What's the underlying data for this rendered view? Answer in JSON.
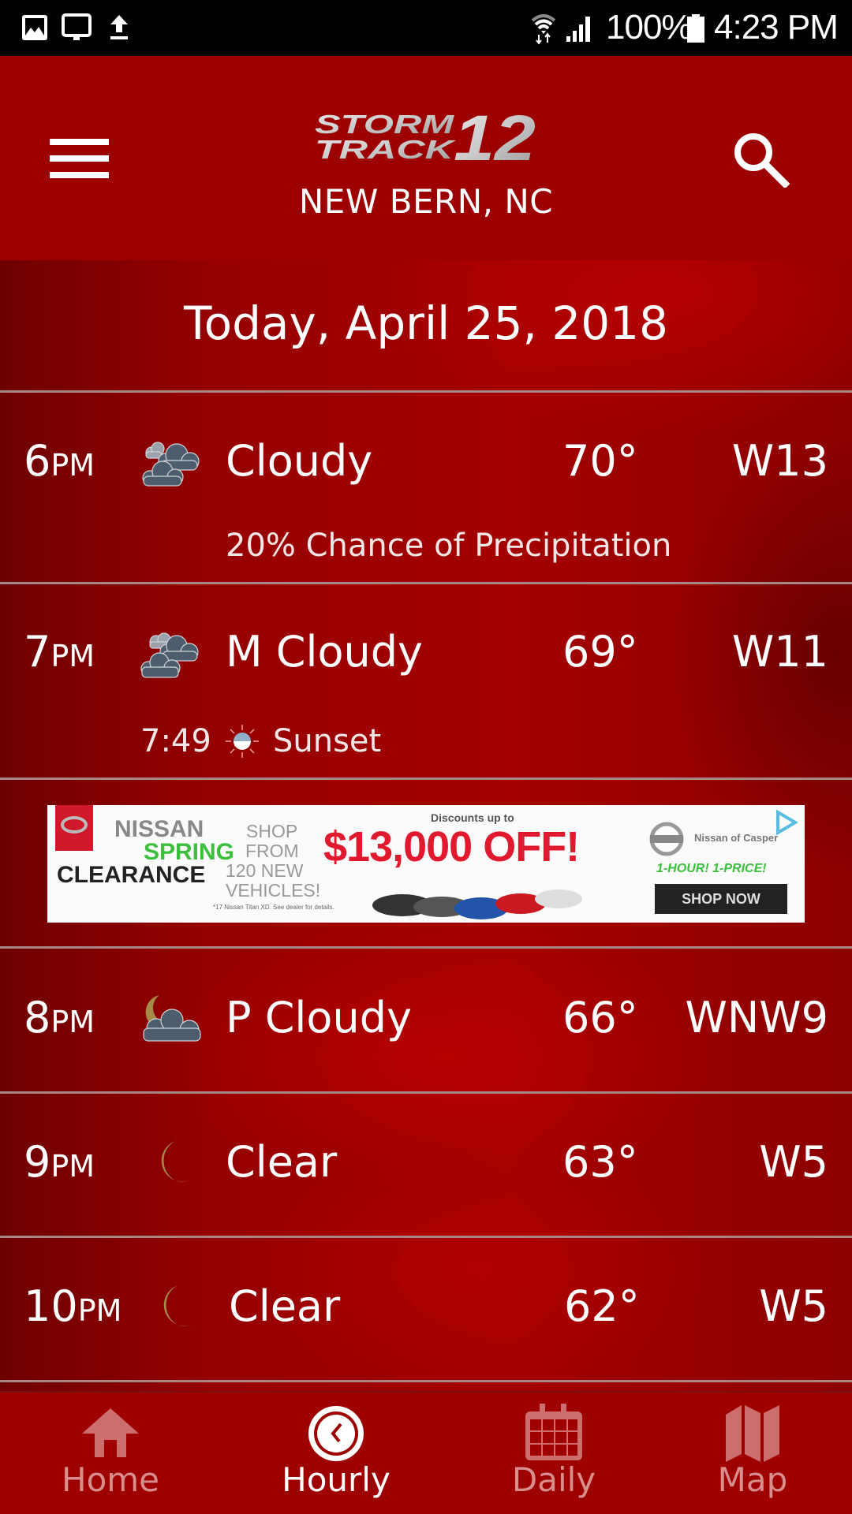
{
  "status_bar": {
    "left_icons": [
      "gallery-icon",
      "cast-screen-icon",
      "upload-icon"
    ],
    "right_icons": [
      "wifi-icon",
      "signal-icon",
      "battery-icon"
    ],
    "battery": "100%",
    "time": "4:23 PM"
  },
  "header": {
    "logo_line1": "STORM",
    "logo_line2": "TRACK",
    "logo_number": "12",
    "city": "NEW BERN, NC",
    "menu_icon": "hamburger-menu-icon",
    "search_icon": "search-icon"
  },
  "date_title": "Today, April 25, 2018",
  "hours": [
    {
      "hour": "6",
      "suffix": "PM",
      "icon": "cloudy-icon",
      "condition": "Cloudy",
      "temp": "70°",
      "wind": "W13",
      "note": "20% Chance of Precipitation"
    },
    {
      "hour": "7",
      "suffix": "PM",
      "icon": "mostly-cloudy-icon",
      "condition": "M Cloudy",
      "temp": "69°",
      "wind": "W11",
      "event": {
        "time": "7:49",
        "icon": "sunset-icon",
        "label": "Sunset"
      }
    },
    {
      "hour": "8",
      "suffix": "PM",
      "icon": "partly-cloudy-night-icon",
      "condition": "P Cloudy",
      "temp": "66°",
      "wind": "WNW9"
    },
    {
      "hour": "9",
      "suffix": "PM",
      "icon": "moon-icon",
      "condition": "Clear",
      "temp": "63°",
      "wind": "W5"
    },
    {
      "hour": "10",
      "suffix": "PM",
      "icon": "moon-icon",
      "condition": "Clear",
      "temp": "62°",
      "wind": "W5"
    }
  ],
  "ad": {
    "line1": "NISSAN",
    "line2": "SPRING",
    "line3": "CLEARANCE",
    "shop1": "SHOP",
    "shop2": "FROM",
    "shop3": "120 NEW",
    "shop4": "VEHICLES!",
    "fineprint": "*17 Nissan Titan XD. See dealer for details.",
    "discount_label": "Discounts up to",
    "discount": "$13,000 OFF!",
    "dealer": "Nissan of Casper",
    "tagline": "1-HOUR! 1-PRICE!",
    "cta": "SHOP NOW",
    "colors": {
      "red": "#e0192e",
      "green": "#3cbf3c",
      "dark": "#222222"
    }
  },
  "bottom_nav": [
    {
      "label": "Home",
      "icon": "home-icon",
      "active": false
    },
    {
      "label": "Hourly",
      "icon": "clock-icon",
      "active": true
    },
    {
      "label": "Daily",
      "icon": "calendar-icon",
      "active": false
    },
    {
      "label": "Map",
      "icon": "map-icon",
      "active": false
    }
  ],
  "colors": {
    "brand_red": "#9c0000",
    "divider": "#a88686",
    "inactive_nav": "#d98e8e",
    "moon": "#a58a4a",
    "cloud": "#4e5d6e"
  }
}
